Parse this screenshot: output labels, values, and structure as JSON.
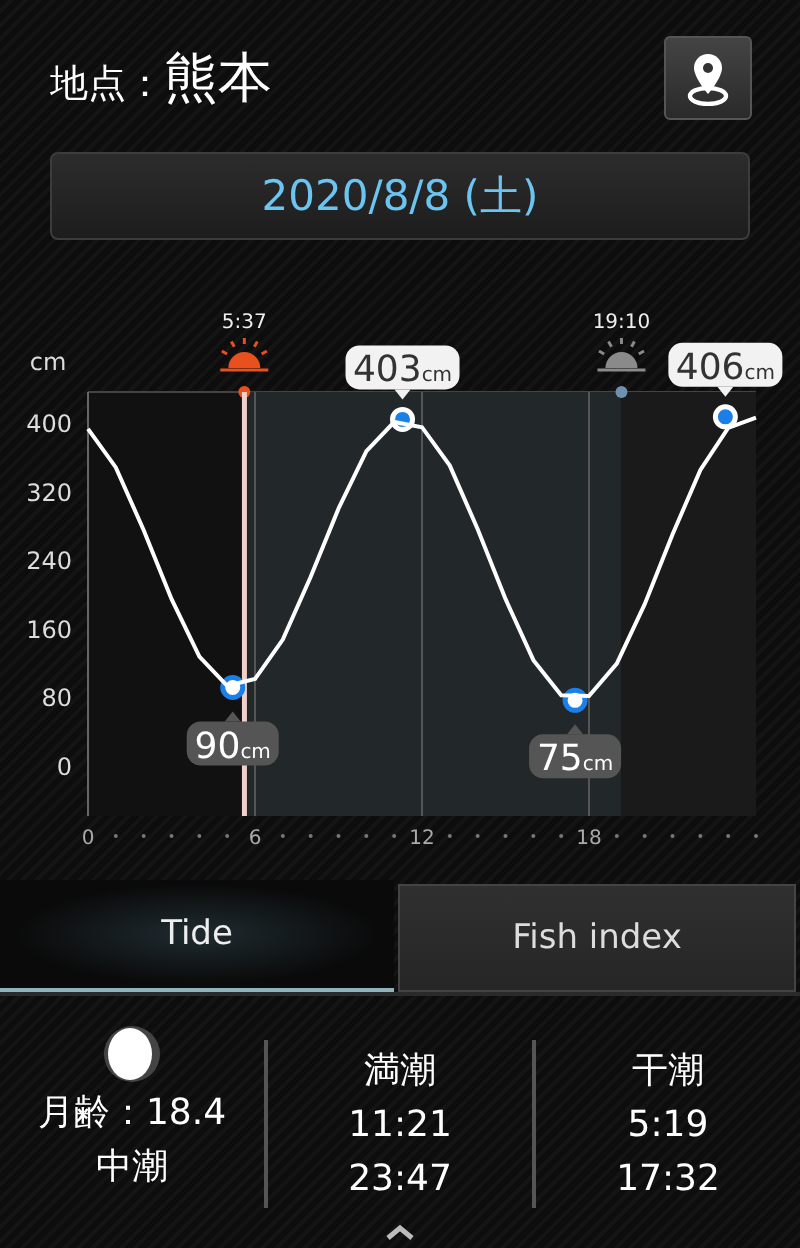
{
  "header": {
    "label": "地点：",
    "location": "熊本"
  },
  "date_button": "2020/8/8 (土)",
  "chart": {
    "sun_events": [
      {
        "kind": "sunrise",
        "time": "5:37"
      },
      {
        "kind": "sunset",
        "time": "19:10"
      }
    ],
    "chart_data": {
      "type": "line",
      "ylabel": "cm",
      "x": [
        0,
        1,
        2,
        3,
        4,
        5,
        6,
        7,
        8,
        9,
        10,
        11,
        12,
        13,
        14,
        15,
        16,
        17,
        18,
        19,
        20,
        21,
        22,
        23,
        24
      ],
      "series": [
        {
          "color": "#ffffff",
          "values": [
            392,
            347,
            274,
            193,
            126,
            92,
            100,
            146,
            219,
            299,
            366,
            400,
            394,
            349,
            275,
            193,
            122,
            81,
            80,
            118,
            187,
            269,
            344,
            393,
            405
          ]
        }
      ],
      "xlim": [
        0,
        24
      ],
      "ylim": [
        -60,
        435
      ],
      "xticks": [
        0,
        6,
        12,
        18
      ],
      "yticks": [
        0,
        80,
        160,
        240,
        320,
        400
      ],
      "grid": true,
      "ref_lines": [
        {
          "axis": "x",
          "value": 5.62,
          "color": "#f0d0c8"
        }
      ],
      "annotations": [
        {
          "x": 5.2,
          "y": 90,
          "text": "90cm"
        },
        {
          "x": 11.3,
          "y": 403,
          "text": "403cm"
        },
        {
          "x": 17.5,
          "y": 75,
          "text": "75cm"
        },
        {
          "x": 22.9,
          "y": 406,
          "text": "406cm"
        }
      ]
    }
  },
  "tabs": [
    {
      "label": "Tide",
      "selected": true
    },
    {
      "label": "Fish index",
      "selected": false
    }
  ],
  "moon": {
    "age": "月齢：18.4",
    "tide_name": "中潮"
  },
  "tide_times": [
    {
      "heading": "満潮",
      "times": [
        "11:21",
        "23:47"
      ]
    },
    {
      "heading": "干潮",
      "times": [
        "5:19",
        "17:32"
      ]
    }
  ]
}
